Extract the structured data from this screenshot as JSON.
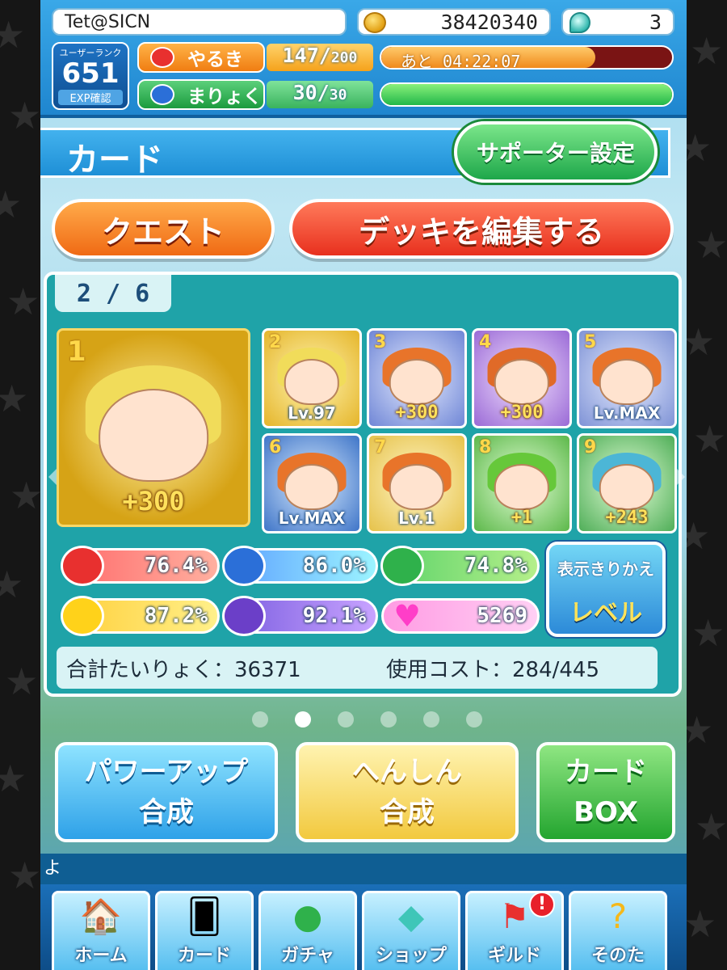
{
  "header": {
    "player_name": "Tet@SICN",
    "coins": "38420340",
    "gems": "3",
    "rank_label": "ユーザーランク",
    "rank_value": "651",
    "exp_label": "EXP確認",
    "stamina_label": "やるき",
    "stamina_current": "147/",
    "stamina_max": "200",
    "stamina_timer": "あと 04:22:07",
    "stamina_fill": 0.735,
    "mana_label": "まりょく",
    "mana_current": "30/",
    "mana_max": "30",
    "mana_fill": 1.0
  },
  "title_bar": {
    "title": "カード",
    "supporter_button": "サポーター設定"
  },
  "actions": {
    "quest": "クエスト",
    "edit_deck": "デッキを編集する"
  },
  "deck": {
    "page": "2 / 6",
    "cards": [
      {
        "num": "1",
        "badge": "+300"
      },
      {
        "num": "2",
        "badge": "Lv.97"
      },
      {
        "num": "3",
        "badge": "+300"
      },
      {
        "num": "4",
        "badge": "+300"
      },
      {
        "num": "5",
        "badge": "Lv.MAX"
      },
      {
        "num": "6",
        "badge": "Lv.MAX"
      },
      {
        "num": "7",
        "badge": "Lv.1"
      },
      {
        "num": "8",
        "badge": "+1"
      },
      {
        "num": "9",
        "badge": "+243"
      }
    ],
    "stats": {
      "red": "76.4%",
      "blue": "86.0%",
      "green": "74.8%",
      "yellow": "87.2%",
      "purple": "92.1%",
      "heart": "5269"
    },
    "toggle_title": "表示きりかえ",
    "toggle_value": "レベル",
    "total_label": "合計たいりょく：36371",
    "cost_label": "使用コスト：284/445"
  },
  "pagination": {
    "active": 2,
    "count": 6
  },
  "bottom_actions": {
    "power_up_line1": "パワーアップ",
    "power_up_line2": "合成",
    "henshin_line1": "へんしん",
    "henshin_line2": "合成",
    "card_box_line1": "カード",
    "card_box_line2": "BOX"
  },
  "ticker": "よ",
  "nav": [
    {
      "label": "ホーム",
      "icon": "house-icon"
    },
    {
      "label": "カード",
      "icon": "card-icon"
    },
    {
      "label": "ガチャ",
      "icon": "puyo-icon"
    },
    {
      "label": "ショップ",
      "icon": "gem-icon"
    },
    {
      "label": "ギルド",
      "icon": "flag-icon",
      "alert": "!"
    },
    {
      "label": "そのた",
      "icon": "question-icon"
    }
  ],
  "colors": {
    "header_blue": "#1f86cf",
    "panel_teal": "#1fa3a8",
    "stamina_orange": "#f08a1c",
    "mana_green": "#22b84a"
  }
}
